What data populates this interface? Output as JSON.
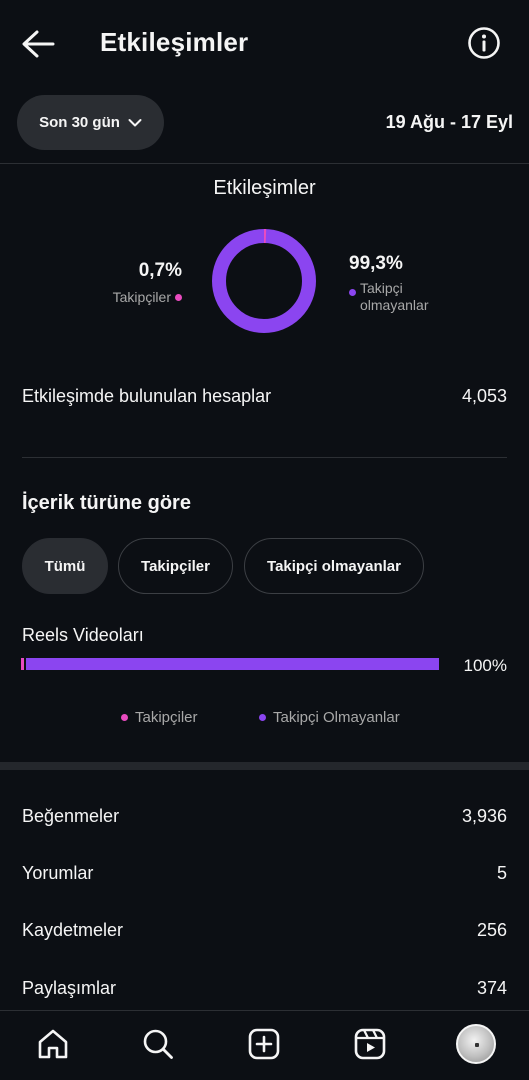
{
  "header": {
    "title": "Etkileşimler",
    "back_icon": "arrow-left-icon",
    "info_icon": "info-icon"
  },
  "filter": {
    "range_label": "Son 30 gün",
    "date_range": "19 Ağu - 17 Eyl"
  },
  "summary": {
    "title": "Etkileşimler",
    "followers_pct": "0,7%",
    "followers_label": "Takipçiler",
    "non_followers_pct": "99,3%",
    "non_followers_label_line1": "Takipçi",
    "non_followers_label_line2": "olmayanlar",
    "followers_fraction": 0.007,
    "colors": {
      "followers": "#e94bbf",
      "non_followers": "#8b45f0"
    }
  },
  "accounts_engaged": {
    "label": "Etkileşimde bulunulan hesaplar",
    "value": "4,053"
  },
  "content_type": {
    "title": "İçerik türüne göre",
    "chips": [
      "Tümü",
      "Takipçiler",
      "Takipçi olmayanlar"
    ],
    "active_chip": "Tümü",
    "reels_label": "Reels Videoları",
    "reels_pct": "100%",
    "reels_followers_fraction": 0.007,
    "legend": [
      "Takipçiler",
      "Takipçi Olmayanlar"
    ]
  },
  "metrics": [
    {
      "label": "Beğenmeler",
      "value": "3,936"
    },
    {
      "label": "Yorumlar",
      "value": "5"
    },
    {
      "label": "Kaydetmeler",
      "value": "256"
    },
    {
      "label": "Paylaşımlar",
      "value": "374"
    }
  ],
  "bottom_nav": {
    "items": [
      "home-icon",
      "search-icon",
      "create-icon",
      "reels-icon",
      "profile-avatar"
    ]
  }
}
